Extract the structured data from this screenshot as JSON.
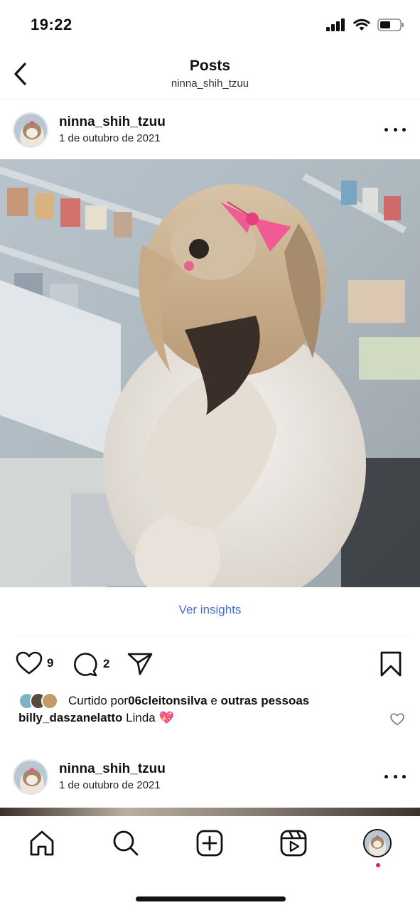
{
  "status_bar": {
    "time": "19:22",
    "icons": [
      "signal-icon",
      "wifi-icon",
      "battery-icon"
    ]
  },
  "header": {
    "title": "Posts",
    "subtitle": "ninna_shih_tzuu",
    "back_icon": "chevron-left-icon"
  },
  "posts": [
    {
      "username": "ninna_shih_tzuu",
      "date": "1 de outubro de 2021",
      "image_subject": "shih tzu dog with pink bow",
      "insights_label": "Ver insights",
      "likes_count": "9",
      "comments_count": "2",
      "liked_by_prefix": "Curtido por ",
      "liked_by_user": "06cleitonsilva",
      "liked_by_join": " e ",
      "liked_by_others": "outras pessoas",
      "comment_user": "billy_daszanelatto",
      "comment_text": " Linda 💖"
    },
    {
      "username": "ninna_shih_tzuu",
      "date": "1 de outubro de 2021"
    }
  ],
  "bottom_nav": [
    "home-icon",
    "search-icon",
    "create-icon",
    "reels-icon",
    "profile-avatar"
  ],
  "colors": {
    "accent_link": "#4a6fcf",
    "notification_dot": "#ed1f4a",
    "text": "#111111"
  }
}
